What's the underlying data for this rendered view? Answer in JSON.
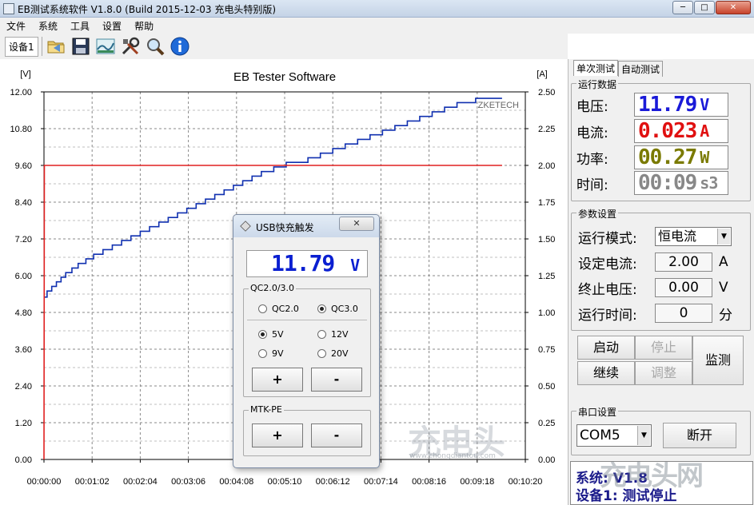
{
  "window": {
    "title": "EB测试系统软件 V1.8.0 (Build 2015-12-03 充电头特别版)",
    "minimize": "─",
    "restore": "□",
    "close": "✕"
  },
  "menu": [
    "文件",
    "系统",
    "工具",
    "设置",
    "帮助"
  ],
  "toolbar": {
    "device_tab": "设备1",
    "icons": [
      "folder-open-icon",
      "save-icon",
      "chart-icon",
      "tools-icon",
      "search-icon",
      "info-icon"
    ]
  },
  "chart_data": {
    "type": "line",
    "title": "EB Tester Software",
    "watermark": "ZKETECH",
    "y_left_unit": "[V]",
    "y_right_unit": "[A]",
    "y_left_ticks": [
      "12.00",
      "10.80",
      "9.60",
      "8.40",
      "7.20",
      "6.00",
      "4.80",
      "3.60",
      "2.40",
      "1.20",
      "0.00"
    ],
    "y_right_ticks": [
      "2.50",
      "2.25",
      "2.00",
      "1.75",
      "1.50",
      "1.25",
      "1.00",
      "0.75",
      "0.50",
      "0.25",
      "0.00"
    ],
    "x_ticks": [
      "00:00:00",
      "00:01:02",
      "00:02:04",
      "00:03:06",
      "00:04:08",
      "00:05:10",
      "00:06:12",
      "00:07:14",
      "00:08:16",
      "00:09:18",
      "00:10:20"
    ],
    "ylim_left": [
      0,
      12
    ],
    "ylim_right": [
      0,
      2.5
    ],
    "xlim_seconds": [
      0,
      620
    ],
    "grid": true,
    "series": [
      {
        "color": "#1030b0",
        "axis": "left",
        "x": [
          0,
          4,
          10,
          16,
          22,
          28,
          36,
          44,
          54,
          64,
          76,
          88,
          100,
          112,
          124,
          136,
          148,
          160,
          172,
          184,
          196,
          208,
          220,
          232,
          244,
          256,
          268,
          280,
          296,
          312,
          318,
          340,
          356,
          372,
          388,
          404,
          420,
          436,
          452,
          468,
          484,
          500,
          516,
          532,
          556,
          590
        ],
        "y": [
          5.3,
          5.5,
          5.65,
          5.8,
          5.95,
          6.1,
          6.25,
          6.4,
          6.55,
          6.7,
          6.85,
          7.0,
          7.15,
          7.3,
          7.45,
          7.6,
          7.75,
          7.9,
          8.05,
          8.2,
          8.35,
          8.5,
          8.65,
          8.8,
          8.95,
          9.1,
          9.25,
          9.4,
          9.55,
          9.7,
          9.7,
          9.85,
          10.0,
          10.15,
          10.3,
          10.45,
          10.6,
          10.75,
          10.9,
          11.05,
          11.2,
          11.35,
          11.5,
          11.65,
          11.79,
          11.79
        ]
      },
      {
        "color": "#e02020",
        "axis": "right",
        "x": [
          0,
          0.5,
          590
        ],
        "y": [
          0,
          2.0,
          2.0
        ]
      }
    ]
  },
  "right_panel": {
    "tabs": [
      "单次测试",
      "自动测试"
    ],
    "run_data": {
      "title": "运行数据",
      "voltage": {
        "label": "电压:",
        "value": "11.79",
        "unit": "V",
        "color": "#1a1ad8"
      },
      "current": {
        "label": "电流:",
        "value": "0.023",
        "unit": "A",
        "color": "#e01010"
      },
      "power": {
        "label": "功率:",
        "value": "00.27",
        "unit": "W",
        "color": "#7a7a00"
      },
      "time": {
        "label": "时间:",
        "value": "00:09",
        "unit": "s3",
        "color": "#888888"
      }
    },
    "params": {
      "title": "参数设置",
      "mode_label": "运行模式:",
      "mode_value": "恒电流",
      "set_current_label": "设定电流:",
      "set_current_value": "2.00",
      "set_current_unit": "A",
      "stop_voltage_label": "终止电压:",
      "stop_voltage_value": "0.00",
      "stop_voltage_unit": "V",
      "run_time_label": "运行时间:",
      "run_time_value": "0",
      "run_time_unit": "分"
    },
    "controls": {
      "start": "启动",
      "stop": "停止",
      "monitor": "监测",
      "continue": "继续",
      "adjust": "调整"
    },
    "serial": {
      "title": "串口设置",
      "port": "COM5",
      "disconnect": "断开"
    },
    "status": {
      "line1": "系统:",
      "line1_rest": "V1.8",
      "line2": "设备1: 测试停止"
    }
  },
  "dialog": {
    "title": "USB快充触发",
    "close": "✕",
    "lcd_value": "11.79",
    "lcd_unit": "V",
    "qc_group": "QC2.0/3.0",
    "qc20": "QC2.0",
    "qc30": "QC3.0",
    "v5": "5V",
    "v12": "12V",
    "v9": "9V",
    "v20": "20V",
    "plus": "+",
    "minus": "-",
    "mtk_group": "MTK-PE",
    "mtk_plus": "+",
    "mtk_minus": "-"
  },
  "watermarks": {
    "big": "充电头",
    "url": "www.chongdiantou.com",
    "corner": "充电头网"
  }
}
